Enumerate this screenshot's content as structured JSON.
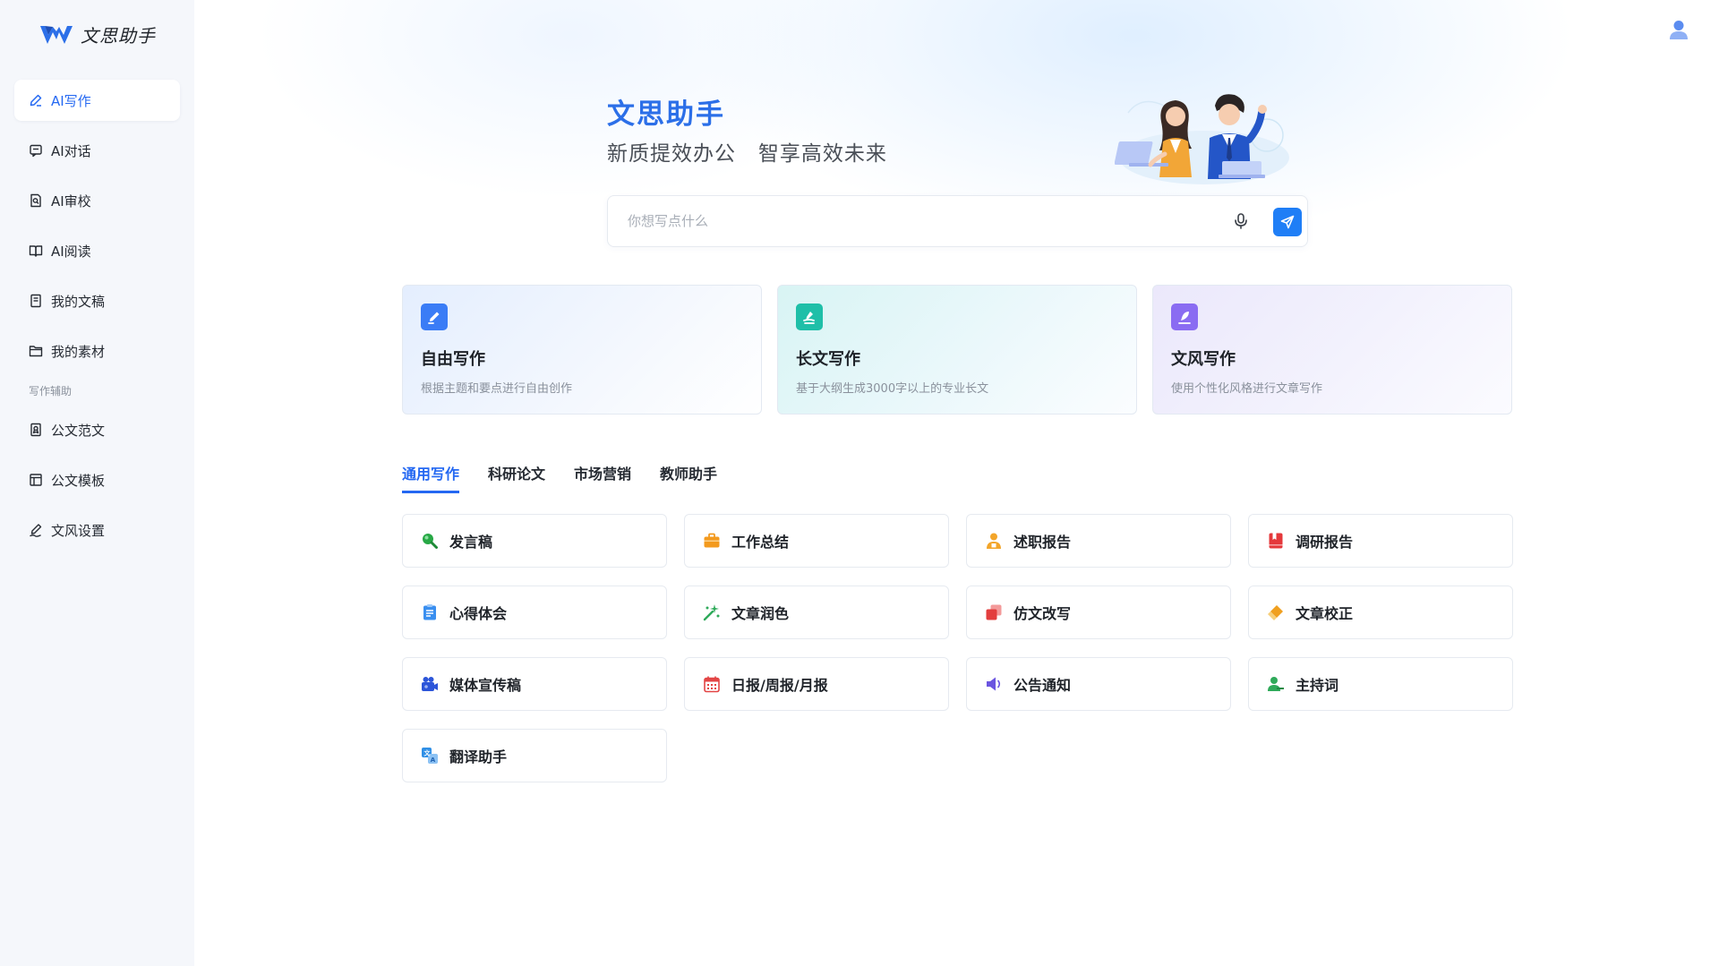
{
  "app": {
    "name": "文思助手",
    "brand_color": "#2468f2"
  },
  "sidebar": {
    "items": [
      {
        "label": "AI写作",
        "icon": "pen-icon",
        "active": true
      },
      {
        "label": "AI对话",
        "icon": "chat-icon"
      },
      {
        "label": "AI审校",
        "icon": "proofread-icon"
      },
      {
        "label": "AI阅读",
        "icon": "book-icon"
      },
      {
        "label": "我的文稿",
        "icon": "document-icon"
      },
      {
        "label": "我的素材",
        "icon": "folder-icon"
      }
    ],
    "section_label": "写作辅助",
    "section_items": [
      {
        "label": "公文范文",
        "icon": "bookmark-doc-icon"
      },
      {
        "label": "公文模板",
        "icon": "template-icon"
      },
      {
        "label": "文风设置",
        "icon": "signature-icon"
      }
    ]
  },
  "hero": {
    "title": "文思助手",
    "subtitle": "新质提效办公   智享高效未来"
  },
  "search": {
    "placeholder": "你想写点什么",
    "value": ""
  },
  "cards": [
    {
      "title": "自由写作",
      "desc": "根据主题和要点进行自由创作",
      "icon": "edit-square-icon",
      "color": "#3a7cf6"
    },
    {
      "title": "长文写作",
      "desc": "基于大纲生成3000字以上的专业长文",
      "icon": "long-text-icon",
      "color": "#1fbfa8"
    },
    {
      "title": "文风写作",
      "desc": "使用个性化风格进行文章写作",
      "icon": "quill-icon",
      "color": "#8a6cf2"
    }
  ],
  "tabs": [
    {
      "label": "通用写作",
      "active": true
    },
    {
      "label": "科研论文"
    },
    {
      "label": "市场营销"
    },
    {
      "label": "教师助手"
    }
  ],
  "templates": [
    {
      "label": "发言稿",
      "icon": "microphone-search-icon",
      "color": "#27a845"
    },
    {
      "label": "工作总结",
      "icon": "briefcase-icon",
      "color": "#f39a1e"
    },
    {
      "label": "述职报告",
      "icon": "person-report-icon",
      "color": "#f3a52a"
    },
    {
      "label": "调研报告",
      "icon": "bookmark-report-icon",
      "color": "#e5383b"
    },
    {
      "label": "心得体会",
      "icon": "clipboard-icon",
      "color": "#3a8ff0"
    },
    {
      "label": "文章润色",
      "icon": "sparkle-icon",
      "color": "#2faa5a"
    },
    {
      "label": "仿文改写",
      "icon": "copy-icon",
      "color": "#e33e3e"
    },
    {
      "label": "文章校正",
      "icon": "eraser-icon",
      "color": "#f0a020"
    },
    {
      "label": "媒体宣传稿",
      "icon": "camera-icon",
      "color": "#2c55d9"
    },
    {
      "label": "日报/周报/月报",
      "icon": "calendar-icon",
      "color": "#e34545"
    },
    {
      "label": "公告通知",
      "icon": "speaker-icon",
      "color": "#6b55e0"
    },
    {
      "label": "主持词",
      "icon": "host-icon",
      "color": "#2faa5a"
    },
    {
      "label": "翻译助手",
      "icon": "translate-icon",
      "color": "#2f8fe6"
    }
  ]
}
